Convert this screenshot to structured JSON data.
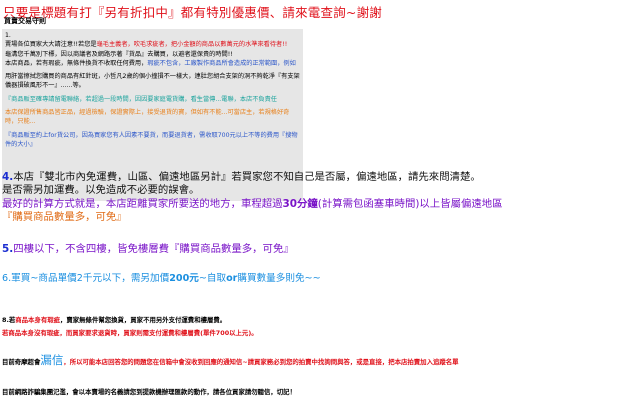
{
  "headline": "只要是標題有打『另有折扣中』都有特別優惠價、請來電查詢~謝謝",
  "subhead": "買賣交易守則",
  "notice": {
    "n1": "1.",
    "l1a": "賣場各位買家大大請注意!!若您是",
    "l1b": "龜毛主義者，吹毛求疵者，把小金額的商品以數萬元的水準來看待者!!",
    "l2a": "龜溝您千萬別下標，因以商議者及網路示著『貨品』去購買，以避者還保貴的時間!!",
    "l3a": "本店商品，若有瑕疵，無條件換貨不收取任何費用，",
    "l3b": "瑕疵不包含，工廠製作商品所會造成的正常範圍，例如",
    "l4a": "用肝當擦拭您購買的商品有紅針斑，小哲凡2歲的個小撞損不一樣大，連肚您胡合支架的洞不夠乾淨『有支架儀器損破風形不一』......等。",
    "l5a": "『商品販至確專請留電聯絡，若超過一段時間，因因要家庭電貨購，看生當傳...電聯，本店不負責任",
    "l6a": "本店保證所售商品皆正品，經過檢驗，保證實際上，接受退貨的寶，但如有不能...可當店主，若規格好奇時，只能...",
    "l7a": "『商品販至約上for貨公司，因為買家您有人因素不要貨，而要退貨者，需收取700元以上不等的費用『搜物件的大小』"
  },
  "sec4": {
    "num": "4.",
    "line1": "本店『雙北市內免運費，山區、偏遠地區另計』若買家您不知自己是否屬，偏遠地區，請先來問清楚。",
    "line2": "是否需另加運費。以免造成不必要的誤會。",
    "line3a": "最好的計算方式就是，本店距離買家所要送的地方，車程超過",
    "line3b": "30分鐘",
    "line3c": "(計算需包函塞車時間)以上皆屬偏遠地區",
    "line4": "『購買商品數量多，可免』"
  },
  "sec5": {
    "num": "5.",
    "text": "四樓以下，不含四樓，皆免樓層費『購買商品數量多，可免』"
  },
  "sec6": {
    "num": "6.",
    "text_a": "軍買~商品單價2千元以下，需另加價",
    "text_b": "200元",
    "text_c": "~自取",
    "text_d": "or",
    "text_e": "購買數量多則免~~"
  },
  "sec8": {
    "line1a": "8.若",
    "line1b": "商品本身有瑕疵",
    "line1c": "，賣家無條件幫您換貨，買家不用另外支付運費和樓層費。",
    "line2": "若商品本身沒有瑕疵，而買家要求退貨時，買家則需支付運費和樓層費(單件700以上元)。"
  },
  "sec9": {
    "prefix": "目前奇摩超會",
    "big": "漏信",
    "rest_a": "，所以可能本店回答您的問題您在信箱中會沒收到回應的通知信~請買家務必到您的拍賣中找詢問與答，",
    "rest_b": "或是直接，把本店拍賣加入追蹤名單"
  },
  "sec10": "目前網路詐騙集團氾濫，會以本賣場的名義請您到提款機辦理匯款的動作，請各位買家請勿聽信，切記！"
}
